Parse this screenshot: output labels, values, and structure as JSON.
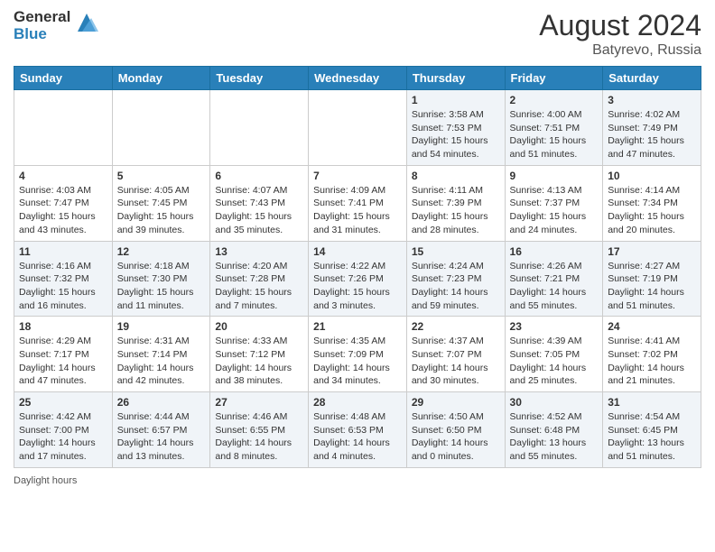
{
  "logo": {
    "general": "General",
    "blue": "Blue"
  },
  "header": {
    "month_year": "August 2024",
    "location": "Batyrevo, Russia"
  },
  "days_of_week": [
    "Sunday",
    "Monday",
    "Tuesday",
    "Wednesday",
    "Thursday",
    "Friday",
    "Saturday"
  ],
  "weeks": [
    [
      {
        "day": "",
        "info": ""
      },
      {
        "day": "",
        "info": ""
      },
      {
        "day": "",
        "info": ""
      },
      {
        "day": "",
        "info": ""
      },
      {
        "day": "1",
        "info": "Sunrise: 3:58 AM\nSunset: 7:53 PM\nDaylight: 15 hours and 54 minutes."
      },
      {
        "day": "2",
        "info": "Sunrise: 4:00 AM\nSunset: 7:51 PM\nDaylight: 15 hours and 51 minutes."
      },
      {
        "day": "3",
        "info": "Sunrise: 4:02 AM\nSunset: 7:49 PM\nDaylight: 15 hours and 47 minutes."
      }
    ],
    [
      {
        "day": "4",
        "info": "Sunrise: 4:03 AM\nSunset: 7:47 PM\nDaylight: 15 hours and 43 minutes."
      },
      {
        "day": "5",
        "info": "Sunrise: 4:05 AM\nSunset: 7:45 PM\nDaylight: 15 hours and 39 minutes."
      },
      {
        "day": "6",
        "info": "Sunrise: 4:07 AM\nSunset: 7:43 PM\nDaylight: 15 hours and 35 minutes."
      },
      {
        "day": "7",
        "info": "Sunrise: 4:09 AM\nSunset: 7:41 PM\nDaylight: 15 hours and 31 minutes."
      },
      {
        "day": "8",
        "info": "Sunrise: 4:11 AM\nSunset: 7:39 PM\nDaylight: 15 hours and 28 minutes."
      },
      {
        "day": "9",
        "info": "Sunrise: 4:13 AM\nSunset: 7:37 PM\nDaylight: 15 hours and 24 minutes."
      },
      {
        "day": "10",
        "info": "Sunrise: 4:14 AM\nSunset: 7:34 PM\nDaylight: 15 hours and 20 minutes."
      }
    ],
    [
      {
        "day": "11",
        "info": "Sunrise: 4:16 AM\nSunset: 7:32 PM\nDaylight: 15 hours and 16 minutes."
      },
      {
        "day": "12",
        "info": "Sunrise: 4:18 AM\nSunset: 7:30 PM\nDaylight: 15 hours and 11 minutes."
      },
      {
        "day": "13",
        "info": "Sunrise: 4:20 AM\nSunset: 7:28 PM\nDaylight: 15 hours and 7 minutes."
      },
      {
        "day": "14",
        "info": "Sunrise: 4:22 AM\nSunset: 7:26 PM\nDaylight: 15 hours and 3 minutes."
      },
      {
        "day": "15",
        "info": "Sunrise: 4:24 AM\nSunset: 7:23 PM\nDaylight: 14 hours and 59 minutes."
      },
      {
        "day": "16",
        "info": "Sunrise: 4:26 AM\nSunset: 7:21 PM\nDaylight: 14 hours and 55 minutes."
      },
      {
        "day": "17",
        "info": "Sunrise: 4:27 AM\nSunset: 7:19 PM\nDaylight: 14 hours and 51 minutes."
      }
    ],
    [
      {
        "day": "18",
        "info": "Sunrise: 4:29 AM\nSunset: 7:17 PM\nDaylight: 14 hours and 47 minutes."
      },
      {
        "day": "19",
        "info": "Sunrise: 4:31 AM\nSunset: 7:14 PM\nDaylight: 14 hours and 42 minutes."
      },
      {
        "day": "20",
        "info": "Sunrise: 4:33 AM\nSunset: 7:12 PM\nDaylight: 14 hours and 38 minutes."
      },
      {
        "day": "21",
        "info": "Sunrise: 4:35 AM\nSunset: 7:09 PM\nDaylight: 14 hours and 34 minutes."
      },
      {
        "day": "22",
        "info": "Sunrise: 4:37 AM\nSunset: 7:07 PM\nDaylight: 14 hours and 30 minutes."
      },
      {
        "day": "23",
        "info": "Sunrise: 4:39 AM\nSunset: 7:05 PM\nDaylight: 14 hours and 25 minutes."
      },
      {
        "day": "24",
        "info": "Sunrise: 4:41 AM\nSunset: 7:02 PM\nDaylight: 14 hours and 21 minutes."
      }
    ],
    [
      {
        "day": "25",
        "info": "Sunrise: 4:42 AM\nSunset: 7:00 PM\nDaylight: 14 hours and 17 minutes."
      },
      {
        "day": "26",
        "info": "Sunrise: 4:44 AM\nSunset: 6:57 PM\nDaylight: 14 hours and 13 minutes."
      },
      {
        "day": "27",
        "info": "Sunrise: 4:46 AM\nSunset: 6:55 PM\nDaylight: 14 hours and 8 minutes."
      },
      {
        "day": "28",
        "info": "Sunrise: 4:48 AM\nSunset: 6:53 PM\nDaylight: 14 hours and 4 minutes."
      },
      {
        "day": "29",
        "info": "Sunrise: 4:50 AM\nSunset: 6:50 PM\nDaylight: 14 hours and 0 minutes."
      },
      {
        "day": "30",
        "info": "Sunrise: 4:52 AM\nSunset: 6:48 PM\nDaylight: 13 hours and 55 minutes."
      },
      {
        "day": "31",
        "info": "Sunrise: 4:54 AM\nSunset: 6:45 PM\nDaylight: 13 hours and 51 minutes."
      }
    ]
  ],
  "footer": {
    "daylight_label": "Daylight hours"
  }
}
